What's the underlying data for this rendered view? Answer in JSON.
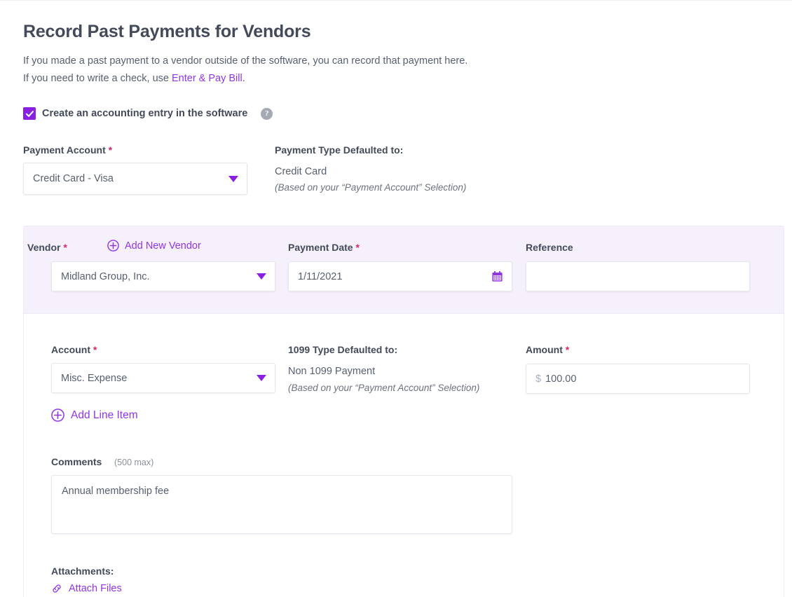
{
  "header": {
    "title": "Record Past Payments for Vendors",
    "intro_line1": "If you made a past payment to a vendor outside of the software, you can record that payment here.",
    "intro_line2_prefix": "If you need to write a check, use ",
    "intro_link": "Enter & Pay Bill",
    "intro_line2_suffix": "."
  },
  "accounting_entry": {
    "label": "Create an accounting entry in the software",
    "checked": true,
    "help_icon": "help-icon",
    "help_glyph": "?"
  },
  "payment_account": {
    "label": "Payment Account",
    "required_mark": "*",
    "value": "Credit Card - Visa",
    "caret_icon": "chevron-down-icon"
  },
  "payment_type": {
    "label": "Payment Type Defaulted to:",
    "value": "Credit Card",
    "note": "(Based on your “Payment Account” Selection)"
  },
  "vendor": {
    "label": "Vendor",
    "required_mark": "*",
    "add_new_label": "Add New Vendor",
    "add_icon": "circle-plus-icon",
    "value": "Midland Group, Inc.",
    "caret_icon": "chevron-down-icon"
  },
  "payment_date": {
    "label": "Payment Date",
    "required_mark": "*",
    "value": "1/11/2021",
    "calendar_icon": "calendar-icon"
  },
  "reference": {
    "label": "Reference",
    "value": "",
    "placeholder": ""
  },
  "account": {
    "label": "Account",
    "required_mark": "*",
    "value": "Misc. Expense",
    "caret_icon": "chevron-down-icon"
  },
  "type_1099": {
    "label": "1099 Type Defaulted to:",
    "value": "Non 1099 Payment",
    "note": "(Based on your “Payment Account” Selection)"
  },
  "amount": {
    "label": "Amount",
    "required_mark": "*",
    "currency_symbol": "$",
    "value": "100.00"
  },
  "add_line_item": {
    "label": "Add Line Item",
    "icon": "circle-plus-icon"
  },
  "comments": {
    "label": "Comments",
    "max_hint": "(500 max)",
    "value": "Annual membership fee",
    "placeholder": ""
  },
  "attachments": {
    "label": "Attachments:",
    "link_label": "Attach Files",
    "icon": "link-chain-icon"
  },
  "colors": {
    "accent_purple": "#9136e3",
    "checkbox_purple": "#8b1fe0",
    "required_red": "#d8256a",
    "card_head_bg": "#f6f0fd",
    "text_dark": "#434a59",
    "text_body": "#576071"
  }
}
